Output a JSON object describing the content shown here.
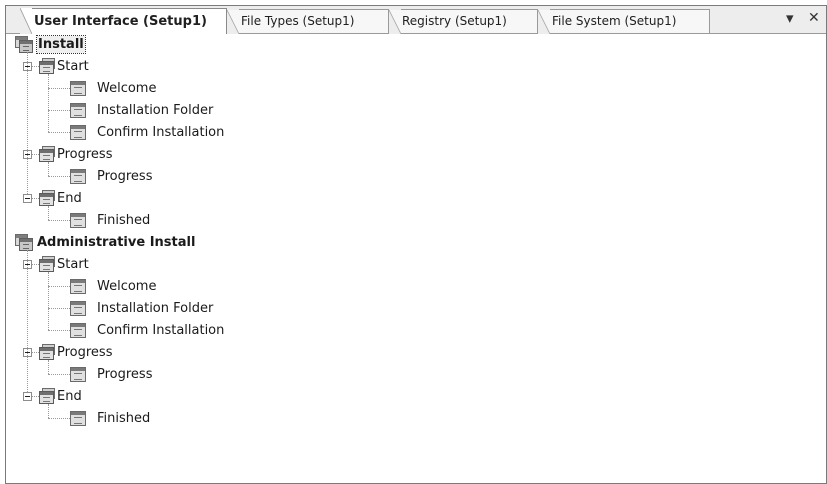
{
  "tabs": [
    {
      "label": "User Interface (Setup1)",
      "active": true
    },
    {
      "label": "File Types (Setup1)",
      "active": false
    },
    {
      "label": "Registry (Setup1)",
      "active": false
    },
    {
      "label": "File System (Setup1)",
      "active": false
    }
  ],
  "toolbar": {
    "pin_glyph": "▾",
    "close_glyph": "✕"
  },
  "tree": [
    {
      "label": "Install",
      "icon": "install-root-icon",
      "selected": true,
      "children": [
        {
          "label": "Start",
          "icon": "sequence-icon",
          "children": [
            {
              "label": "Welcome",
              "icon": "dialog-icon"
            },
            {
              "label": "Installation Folder",
              "icon": "dialog-icon"
            },
            {
              "label": "Confirm Installation",
              "icon": "dialog-icon"
            }
          ]
        },
        {
          "label": "Progress",
          "icon": "sequence-icon",
          "children": [
            {
              "label": "Progress",
              "icon": "dialog-icon"
            }
          ]
        },
        {
          "label": "End",
          "icon": "sequence-icon",
          "children": [
            {
              "label": "Finished",
              "icon": "dialog-icon"
            }
          ]
        }
      ]
    },
    {
      "label": "Administrative Install",
      "icon": "install-root-icon",
      "selected": false,
      "children": [
        {
          "label": "Start",
          "icon": "sequence-icon",
          "children": [
            {
              "label": "Welcome",
              "icon": "dialog-icon"
            },
            {
              "label": "Installation Folder",
              "icon": "dialog-icon"
            },
            {
              "label": "Confirm Installation",
              "icon": "dialog-icon"
            }
          ]
        },
        {
          "label": "Progress",
          "icon": "sequence-icon",
          "children": [
            {
              "label": "Progress",
              "icon": "dialog-icon"
            }
          ]
        },
        {
          "label": "End",
          "icon": "sequence-icon",
          "children": [
            {
              "label": "Finished",
              "icon": "dialog-icon"
            }
          ]
        }
      ]
    }
  ]
}
